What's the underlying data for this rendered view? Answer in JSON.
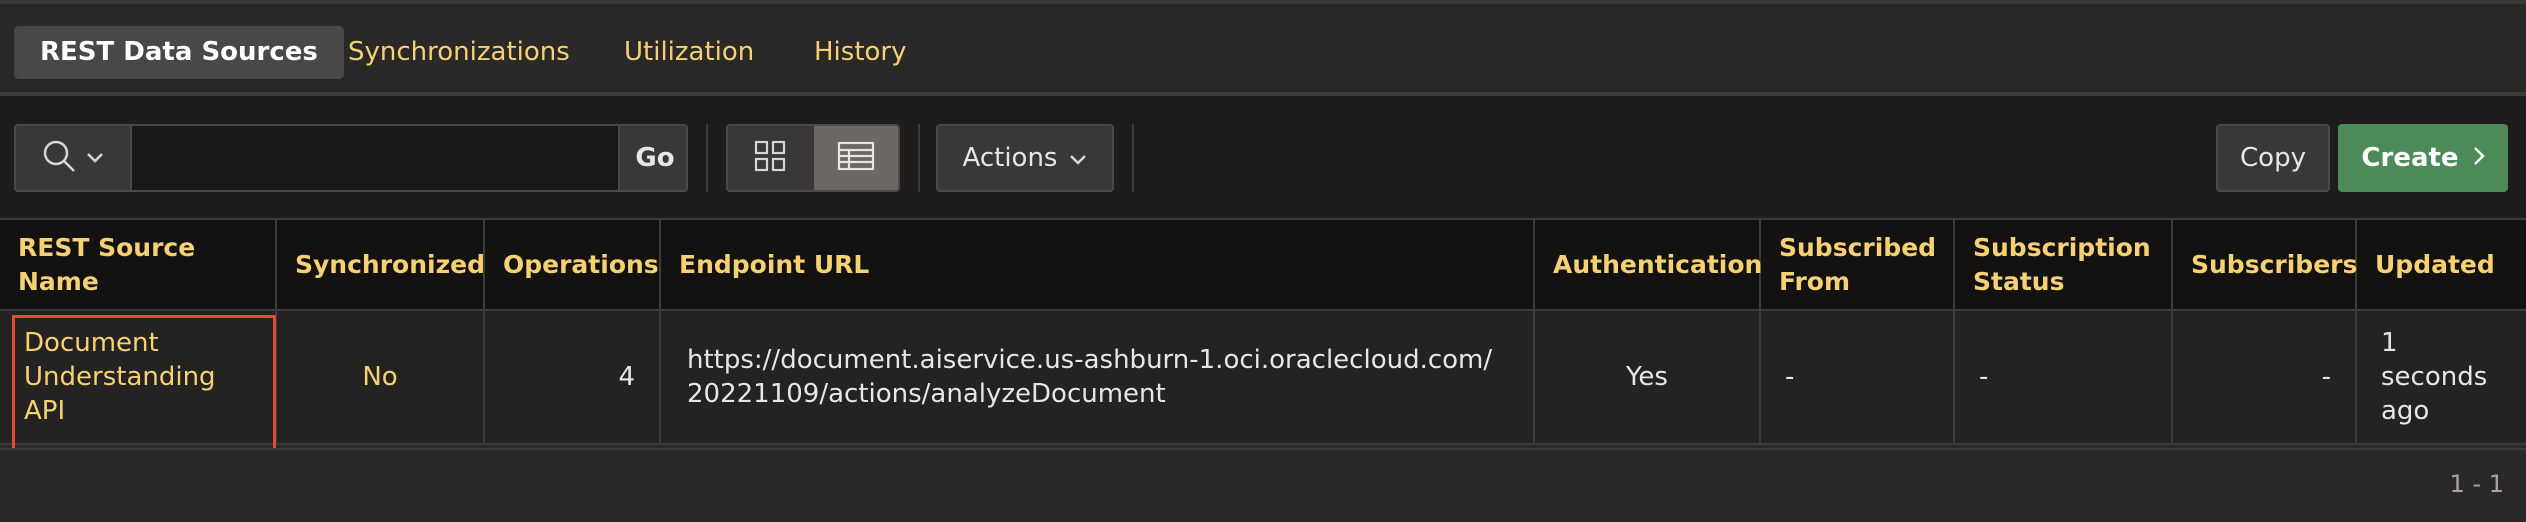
{
  "tabs": [
    {
      "label": "REST Data Sources",
      "active": true
    },
    {
      "label": "Synchronizations",
      "active": false
    },
    {
      "label": "Utilization",
      "active": false
    },
    {
      "label": "History",
      "active": false
    }
  ],
  "toolbar": {
    "search_icon": "search-icon",
    "search_value": "",
    "go_label": "Go",
    "view_icons": [
      "grid-view-icon",
      "table-view-icon"
    ],
    "selected_view": "table",
    "actions_label": "Actions",
    "copy_label": "Copy",
    "create_label": "Create",
    "create_color": "#4d8a5a"
  },
  "table": {
    "columns": [
      "REST Source Name",
      "Synchronized",
      "Operations",
      "Endpoint URL",
      "Authentication",
      "Subscribed From",
      "Subscription Status",
      "Subscribers",
      "Updated"
    ],
    "rows": [
      {
        "name": "Document Understanding API",
        "synchronized": "No",
        "operations": "4",
        "endpoint": "https://document.aiservice.us-ashburn-1.oci.oraclecloud.com/20221109/actions/analyzeDocument",
        "authentication": "Yes",
        "subscribed_from": "-",
        "subscription_status": "-",
        "subscribers": "-",
        "updated": "1 seconds ago"
      }
    ]
  },
  "pagination": "1 - 1",
  "colors": {
    "accent": "#f5d173",
    "highlight": "#e24b2c"
  }
}
